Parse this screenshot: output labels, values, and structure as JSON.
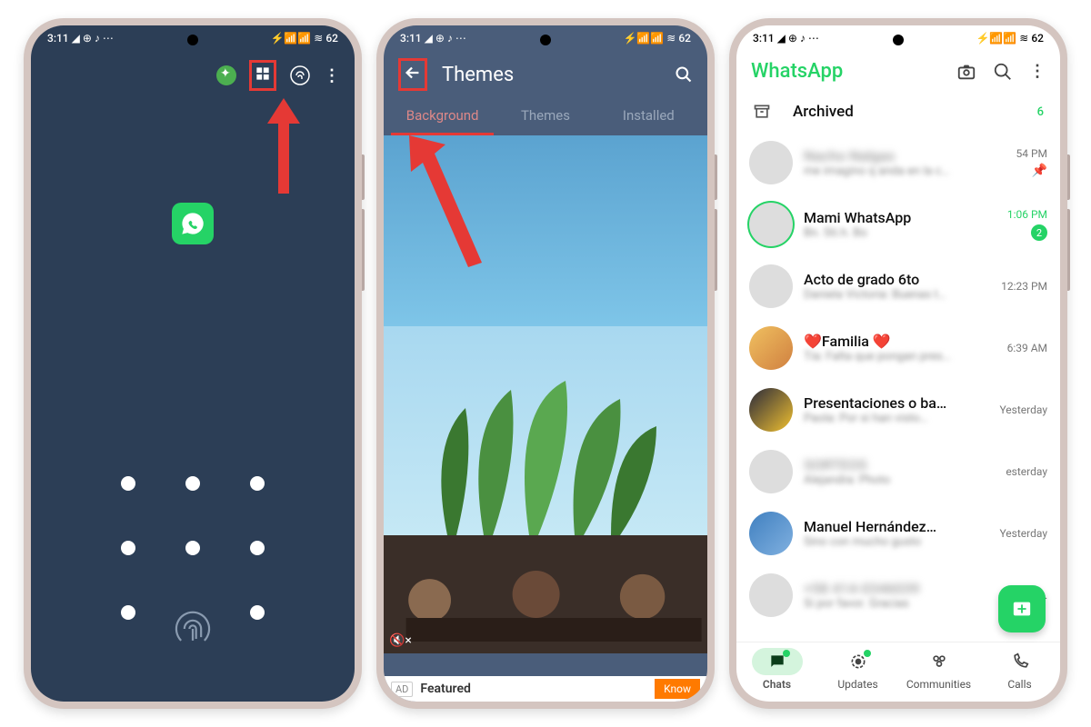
{
  "status": {
    "time": "3:11",
    "battery": "62"
  },
  "phone1": {
    "highlight": "themes-toolbar-icon"
  },
  "phone2": {
    "title": "Themes",
    "tabs": {
      "background": "Background",
      "themes": "Themes",
      "installed": "Installed"
    },
    "ad": {
      "label": "AD",
      "featured": "Featured",
      "cta": "Know"
    }
  },
  "phone3": {
    "app": "WhatsApp",
    "archived": {
      "label": "Archived",
      "count": "6"
    },
    "chats": [
      {
        "name": "Nacho Nalgas",
        "msg": "me imagino q anda en la c…",
        "time": "54 PM",
        "pinned": true,
        "blurred": true
      },
      {
        "name": "Mami WhatsApp",
        "msg": "Bn. Sti.h. Bo",
        "time": "1:06 PM",
        "unread": "2",
        "green": true
      },
      {
        "name": "Acto de grado 6to",
        "msg": "Daniela Victoria: Buenas t…",
        "time": "12:23 PM"
      },
      {
        "name": "❤️Familia ❤️",
        "msg": "Tía: Falta que pongan pres…",
        "time": "6:39 AM"
      },
      {
        "name": "Presentaciones o ba…",
        "msg": "Paola: Por si han visto…",
        "time": "Yesterday"
      },
      {
        "name": "SORTEOS",
        "msg": "Alejandra: Photo",
        "time": "esterday",
        "blurred": true
      },
      {
        "name": "Manuel Hernández…",
        "msg": "Sino con mucho gusto",
        "time": "Yesterday"
      },
      {
        "name": "+58 414-0346039",
        "msg": "Si por favor. Gracias",
        "time": "Yest…",
        "blurred": true
      }
    ],
    "nav": {
      "chats": "Chats",
      "updates": "Updates",
      "communities": "Communities",
      "calls": "Calls"
    }
  }
}
